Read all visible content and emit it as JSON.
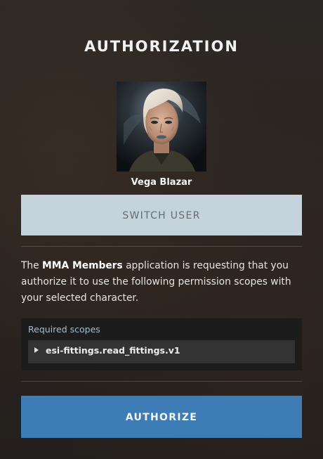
{
  "header": {
    "title": "AUTHORIZATION"
  },
  "character": {
    "name": "Vega Blazar"
  },
  "actions": {
    "switch_user_label": "SWITCH USER",
    "authorize_label": "AUTHORIZE"
  },
  "description": {
    "prefix": "The ",
    "app_name": "MMA Members",
    "suffix": " application is requesting that you authorize it to use the following permission scopes with your selected character."
  },
  "scopes": {
    "heading": "Required scopes",
    "items": [
      {
        "label": "esi-fittings.read_fittings.v1",
        "expanded": false
      }
    ]
  },
  "colors": {
    "switch_button_bg": "#c5d3dc",
    "authorize_button_bg": "#3e7cb5",
    "scopes_heading": "#a7bccb"
  }
}
